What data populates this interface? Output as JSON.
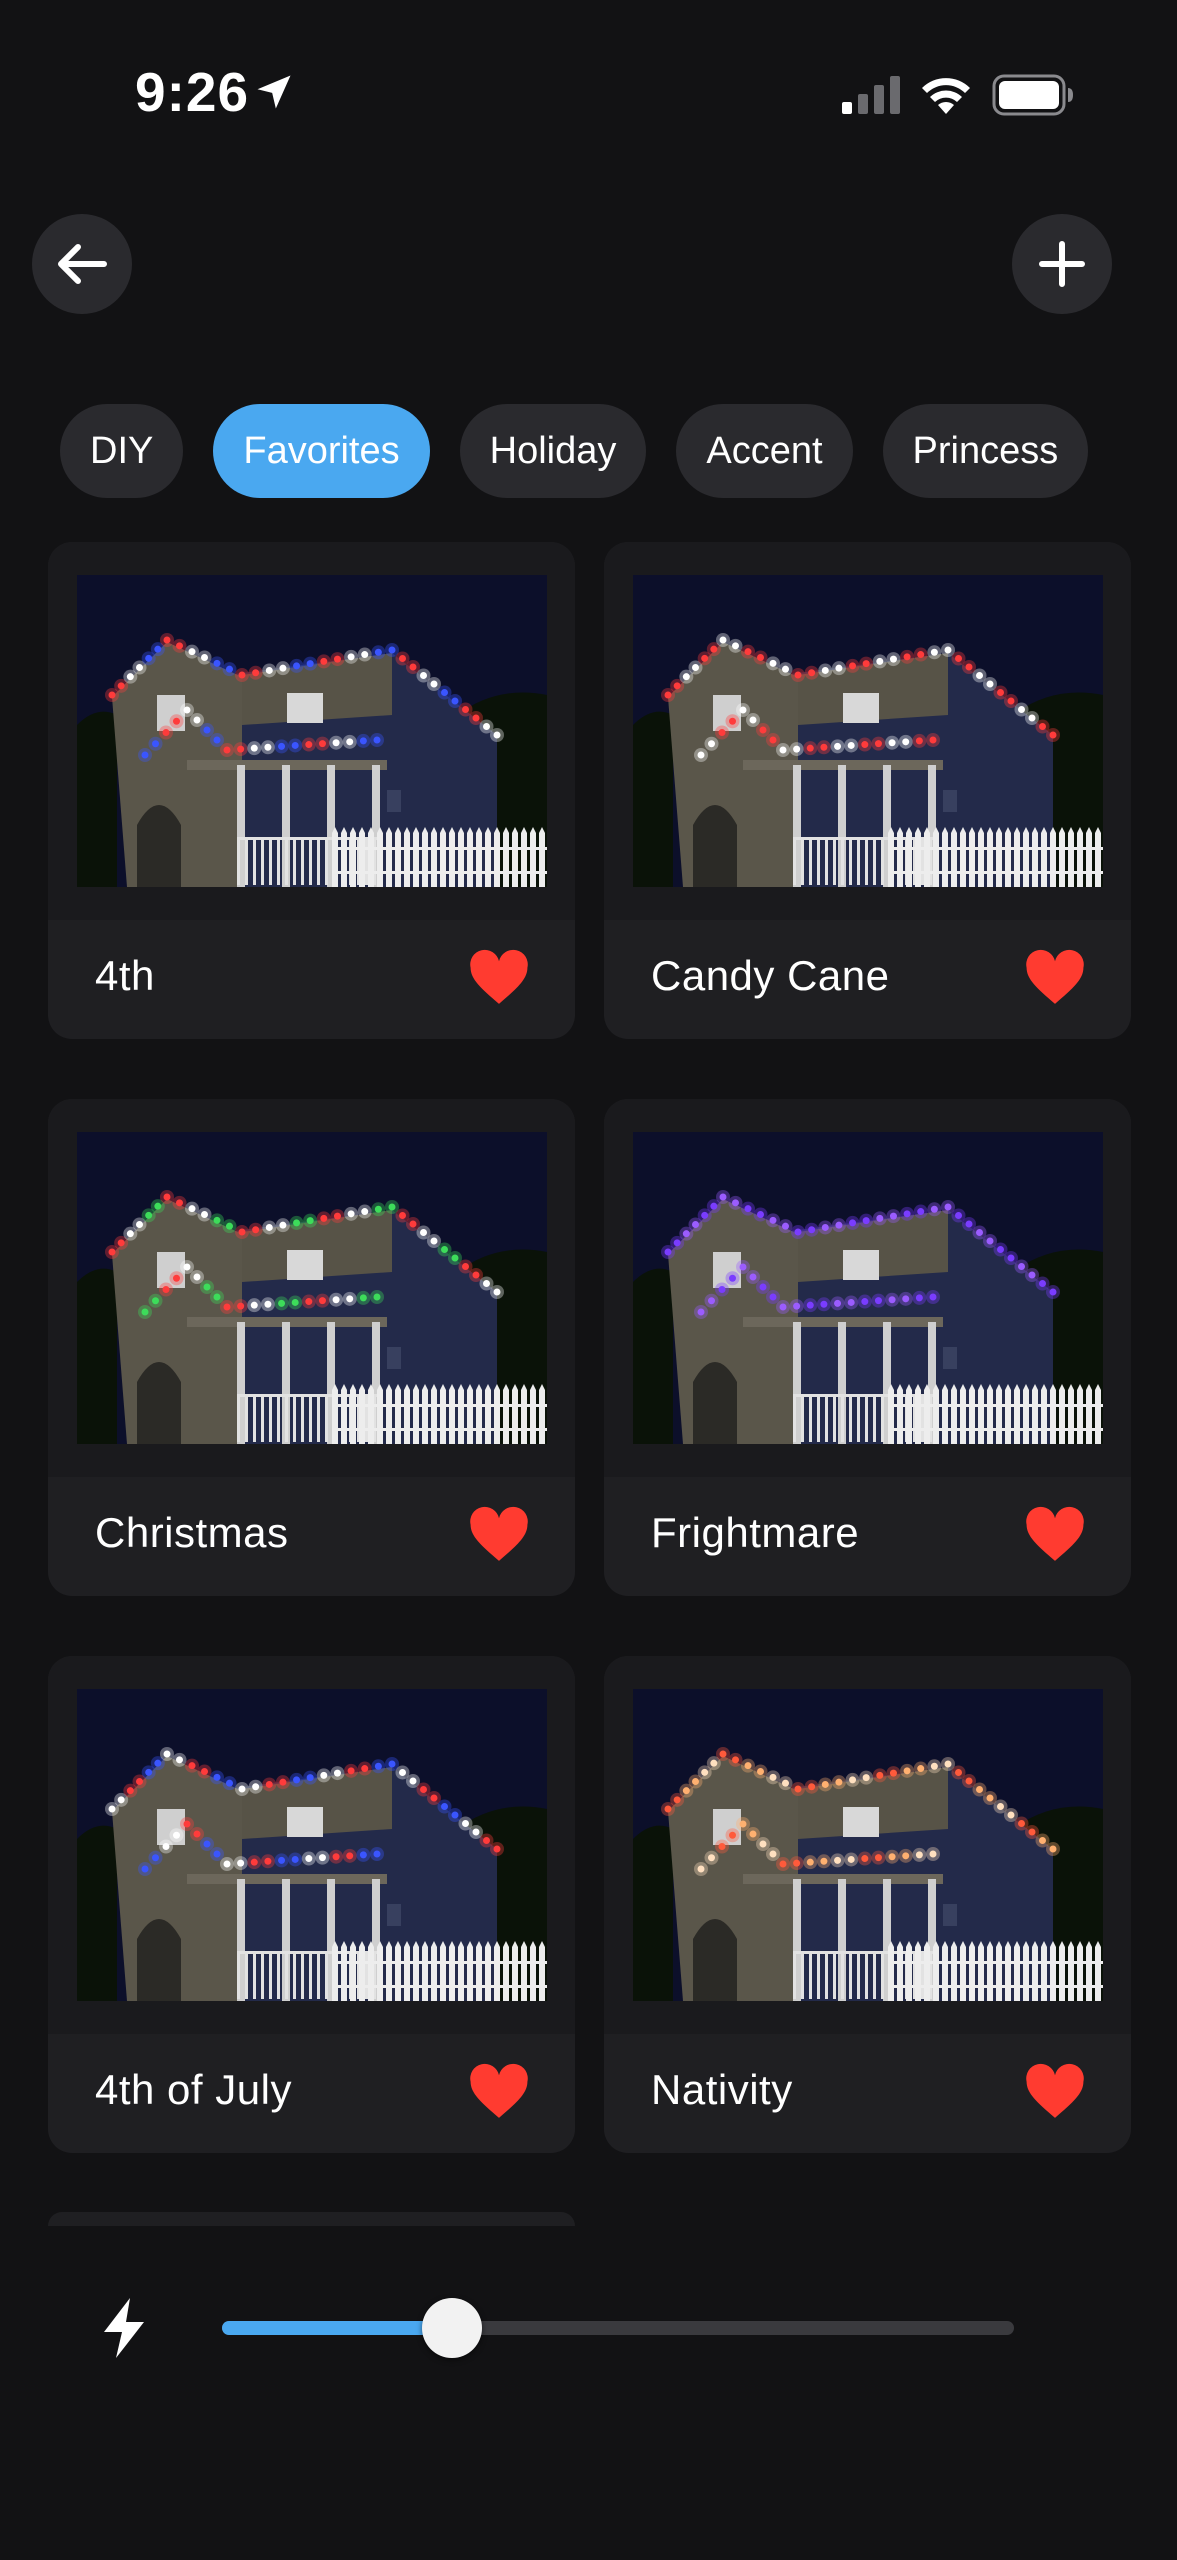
{
  "status_bar": {
    "time": "9:26",
    "location_icon": "location-arrow-icon",
    "signal_icon": "cellular-signal-icon",
    "wifi_icon": "wifi-icon",
    "battery_icon": "battery-icon"
  },
  "nav": {
    "back_icon": "arrow-left-icon",
    "add_icon": "plus-icon"
  },
  "tabs": [
    {
      "label": "DIY",
      "active": false
    },
    {
      "label": "Favorites",
      "active": true
    },
    {
      "label": "Holiday",
      "active": false
    },
    {
      "label": "Accent",
      "active": false
    },
    {
      "label": "Princess",
      "active": false
    }
  ],
  "patterns": [
    {
      "name": "4th",
      "favorite": true,
      "lights": [
        "#ff3b3b",
        "#ffffff",
        "#3a55ff"
      ]
    },
    {
      "name": "Candy Cane",
      "favorite": true,
      "lights": [
        "#ff3b3b",
        "#ffffff"
      ]
    },
    {
      "name": "Christmas",
      "favorite": true,
      "lights": [
        "#ff3b3b",
        "#ffffff",
        "#3ddc5a"
      ]
    },
    {
      "name": "Frightmare",
      "favorite": true,
      "lights": [
        "#7a3cff",
        "#9b5cff"
      ]
    },
    {
      "name": "4th of July",
      "favorite": true,
      "lights": [
        "#ffffff",
        "#ff3b3b",
        "#3a55ff"
      ]
    },
    {
      "name": "Nativity",
      "favorite": true,
      "lights": [
        "#ff5a3b",
        "#ffb070",
        "#ffe0c0"
      ]
    }
  ],
  "brightness": {
    "icon": "lightning-bolt-icon",
    "value": 0.29
  },
  "colors": {
    "accent": "#4aa8f0",
    "heart": "#ff3b30",
    "background": "#121214",
    "card": "#1f1f22"
  }
}
